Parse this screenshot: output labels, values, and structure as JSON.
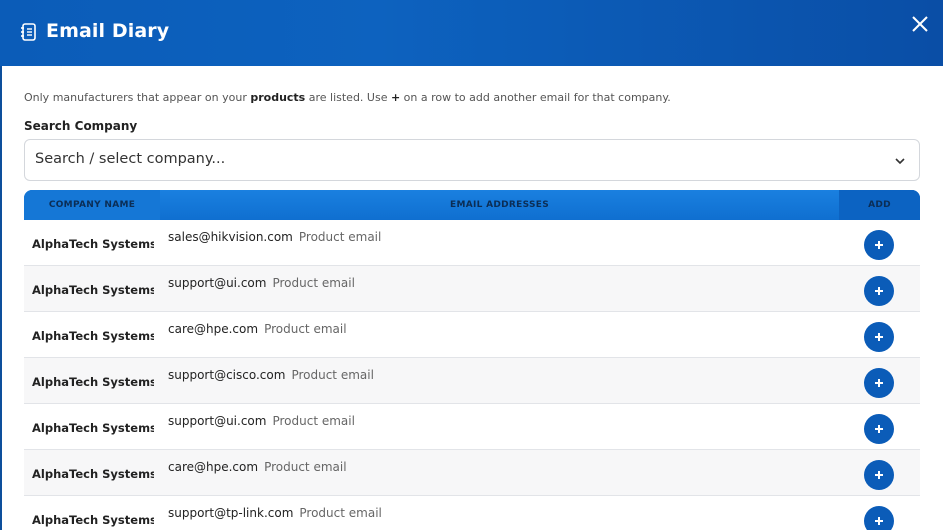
{
  "header": {
    "title": "Email Diary",
    "title_icon": "notebook-icon",
    "close_icon": "close-icon"
  },
  "hint": {
    "part1": "Only manufacturers that appear on your ",
    "bold1": "products",
    "part2": " are listed. Use ",
    "bold2": "+",
    "part3": " on a row to add another email for that company."
  },
  "search": {
    "label": "Search Company",
    "placeholder": "Search / select company..."
  },
  "table": {
    "headers": [
      "COMPANY NAME",
      "EMAIL ADDRESSES",
      "ADD"
    ],
    "rows": [
      {
        "company": "AlphaTech Systems",
        "email": "sales@hikvision.com",
        "tag": "Product email"
      },
      {
        "company": "AlphaTech Systems",
        "email": "support@ui.com",
        "tag": "Product email"
      },
      {
        "company": "AlphaTech Systems",
        "email": "care@hpe.com",
        "tag": "Product email"
      },
      {
        "company": "AlphaTech Systems",
        "email": "support@cisco.com",
        "tag": "Product email"
      },
      {
        "company": "AlphaTech Systems",
        "email": "support@ui.com",
        "tag": "Product email"
      },
      {
        "company": "AlphaTech Systems",
        "email": "care@hpe.com",
        "tag": "Product email"
      },
      {
        "company": "AlphaTech Systems",
        "email": "support@tp-link.com",
        "tag": "Product email"
      }
    ]
  },
  "colors": {
    "brand": "#0b5cb8",
    "header_row": "#0f6fd0"
  }
}
